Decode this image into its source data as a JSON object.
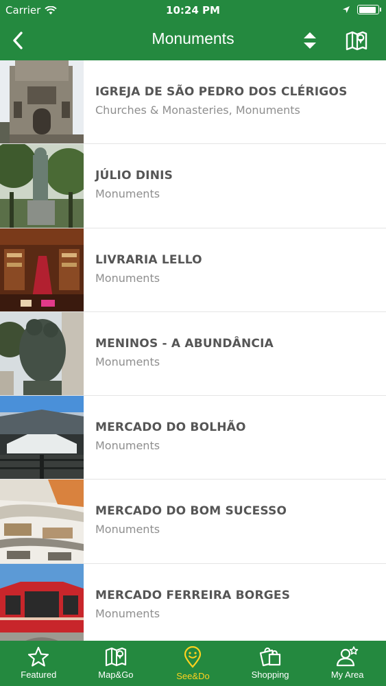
{
  "status": {
    "carrier": "Carrier",
    "time": "10:24 PM",
    "battery_level": 0.92
  },
  "nav": {
    "title": "Monuments",
    "back_icon": "chevron-left-icon",
    "sort_icon": "sort-icon",
    "map_icon": "map-icon"
  },
  "items": [
    {
      "title": "IGREJA DE SÃO PEDRO DOS CLÉRIGOS",
      "subtitle": "Churches & Monasteries, Monuments"
    },
    {
      "title": "JÚLIO DINIS",
      "subtitle": "Monuments"
    },
    {
      "title": "LIVRARIA LELLO",
      "subtitle": "Monuments"
    },
    {
      "title": "MENINOS - A ABUNDÂNCIA",
      "subtitle": "Monuments"
    },
    {
      "title": "MERCADO DO BOLHÃO",
      "subtitle": "Monuments"
    },
    {
      "title": "MERCADO DO BOM SUCESSO",
      "subtitle": "Monuments"
    },
    {
      "title": "MERCADO FERREIRA BORGES",
      "subtitle": "Monuments"
    }
  ],
  "tabs": [
    {
      "label": "Featured",
      "icon": "star-icon"
    },
    {
      "label": "Map&Go",
      "icon": "map-icon"
    },
    {
      "label": "See&Do",
      "icon": "smiley-pin-icon",
      "active": true
    },
    {
      "label": "Shopping",
      "icon": "shopping-bags-icon"
    },
    {
      "label": "My Area",
      "icon": "user-star-icon"
    }
  ],
  "colors": {
    "brand_green": "#24893f",
    "active_tab": "#ffd21f",
    "title_text": "#555555",
    "subtitle_text": "#8e8e8e"
  }
}
